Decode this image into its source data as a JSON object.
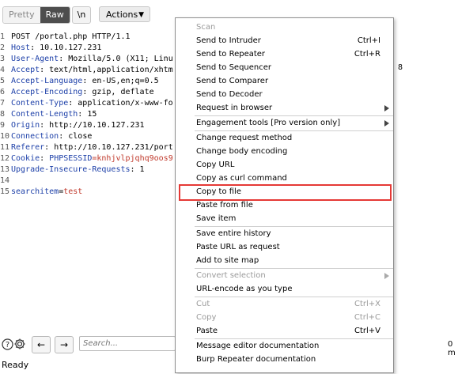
{
  "toolbar": {
    "pretty_label": "Pretty",
    "raw_label": "Raw",
    "newline_label": "\\n",
    "actions_label": "Actions"
  },
  "editor": {
    "lines": [
      {
        "n": "1",
        "parts": [
          {
            "t": "POST /portal.php HTTP/1.1",
            "c": "txt"
          }
        ]
      },
      {
        "n": "2",
        "parts": [
          {
            "t": "Host",
            "c": "hname"
          },
          {
            "t": ": 10.10.127.231",
            "c": "txt"
          }
        ]
      },
      {
        "n": "3",
        "parts": [
          {
            "t": "User-Agent",
            "c": "hname"
          },
          {
            "t": ": Mozilla/5.0 (X11; Linu",
            "c": "txt"
          }
        ]
      },
      {
        "n": "4",
        "parts": [
          {
            "t": "Accept",
            "c": "hname"
          },
          {
            "t": ": text/html,application/xhtm",
            "c": "txt"
          }
        ]
      },
      {
        "n": "5",
        "parts": [
          {
            "t": "Accept-Language",
            "c": "hname"
          },
          {
            "t": ": en-US,en;q=0.5",
            "c": "txt"
          }
        ]
      },
      {
        "n": "6",
        "parts": [
          {
            "t": "Accept-Encoding",
            "c": "hname"
          },
          {
            "t": ": gzip, deflate",
            "c": "txt"
          }
        ]
      },
      {
        "n": "7",
        "parts": [
          {
            "t": "Content-Type",
            "c": "hname"
          },
          {
            "t": ": application/x-www-fo",
            "c": "txt"
          }
        ]
      },
      {
        "n": "8",
        "parts": [
          {
            "t": "Content-Length",
            "c": "hname"
          },
          {
            "t": ": 15",
            "c": "txt"
          }
        ]
      },
      {
        "n": "9",
        "parts": [
          {
            "t": "Origin",
            "c": "hname"
          },
          {
            "t": ": http://10.10.127.231",
            "c": "txt"
          }
        ]
      },
      {
        "n": "10",
        "parts": [
          {
            "t": "Connection",
            "c": "hname"
          },
          {
            "t": ": close",
            "c": "txt"
          }
        ]
      },
      {
        "n": "11",
        "parts": [
          {
            "t": "Referer",
            "c": "hname"
          },
          {
            "t": ": http://10.10.127.231/port",
            "c": "txt"
          }
        ]
      },
      {
        "n": "12",
        "parts": [
          {
            "t": "Cookie",
            "c": "hname"
          },
          {
            "t": ": ",
            "c": "txt"
          },
          {
            "t": "PHPSESSID",
            "c": "pname"
          },
          {
            "t": "=knhjvlpjqhq9oos9",
            "c": "cval"
          }
        ]
      },
      {
        "n": "13",
        "parts": [
          {
            "t": "Upgrade-Insecure-Requests",
            "c": "hname"
          },
          {
            "t": ": 1",
            "c": "txt"
          }
        ]
      },
      {
        "n": "14",
        "parts": []
      },
      {
        "n": "15",
        "parts": [
          {
            "t": "searchitem",
            "c": "pname"
          },
          {
            "t": "=",
            "c": "txt"
          },
          {
            "t": "test",
            "c": "pval"
          }
        ]
      }
    ],
    "stray_char": "8"
  },
  "bottom": {
    "search_placeholder": "Search...",
    "matches_text": "0 m",
    "status": "Ready"
  },
  "menu": {
    "items": [
      {
        "label": "Scan",
        "shortcut": "",
        "disabled": true,
        "submenu": false
      },
      {
        "label": "Send to Intruder",
        "shortcut": "Ctrl+I",
        "disabled": false,
        "submenu": false
      },
      {
        "label": "Send to Repeater",
        "shortcut": "Ctrl+R",
        "disabled": false,
        "submenu": false
      },
      {
        "label": "Send to Sequencer",
        "shortcut": "",
        "disabled": false,
        "submenu": false
      },
      {
        "label": "Send to Comparer",
        "shortcut": "",
        "disabled": false,
        "submenu": false
      },
      {
        "label": "Send to Decoder",
        "shortcut": "",
        "disabled": false,
        "submenu": false
      },
      {
        "label": "Request in browser",
        "shortcut": "",
        "disabled": false,
        "submenu": true
      },
      {
        "label": "Engagement tools [Pro version only]",
        "shortcut": "",
        "disabled": false,
        "submenu": true
      },
      {
        "label": "Change request method",
        "shortcut": "",
        "disabled": false,
        "submenu": false
      },
      {
        "label": "Change body encoding",
        "shortcut": "",
        "disabled": false,
        "submenu": false
      },
      {
        "label": "Copy URL",
        "shortcut": "",
        "disabled": false,
        "submenu": false
      },
      {
        "label": "Copy as curl command",
        "shortcut": "",
        "disabled": false,
        "submenu": false
      },
      {
        "label": "Copy to file",
        "shortcut": "",
        "disabled": false,
        "submenu": false
      },
      {
        "label": "Paste from file",
        "shortcut": "",
        "disabled": false,
        "submenu": false
      },
      {
        "label": "Save item",
        "shortcut": "",
        "disabled": false,
        "submenu": false
      },
      {
        "label": "Save entire history",
        "shortcut": "",
        "disabled": false,
        "submenu": false
      },
      {
        "label": "Paste URL as request",
        "shortcut": "",
        "disabled": false,
        "submenu": false
      },
      {
        "label": "Add to site map",
        "shortcut": "",
        "disabled": false,
        "submenu": false
      },
      {
        "label": "Convert selection",
        "shortcut": "",
        "disabled": true,
        "submenu": true
      },
      {
        "label": "URL-encode as you type",
        "shortcut": "",
        "disabled": false,
        "submenu": false
      },
      {
        "label": "Cut",
        "shortcut": "Ctrl+X",
        "disabled": true,
        "submenu": false
      },
      {
        "label": "Copy",
        "shortcut": "Ctrl+C",
        "disabled": true,
        "submenu": false
      },
      {
        "label": "Paste",
        "shortcut": "Ctrl+V",
        "disabled": false,
        "submenu": false
      },
      {
        "label": "Message editor documentation",
        "shortcut": "",
        "disabled": false,
        "submenu": false
      },
      {
        "label": "Burp Repeater documentation",
        "shortcut": "",
        "disabled": false,
        "submenu": false
      }
    ],
    "highlighted_item": "Copy to file",
    "highlight_color": "#e53935"
  },
  "icons": [
    "help-icon",
    "settings-icon",
    "back-arrow-icon",
    "forward-arrow-icon",
    "chevron-down-icon",
    "submenu-arrow-icon"
  ]
}
